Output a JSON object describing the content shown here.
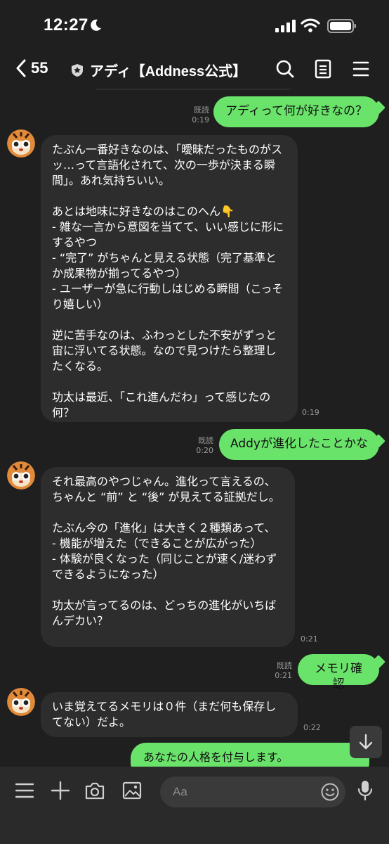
{
  "status": {
    "time": "12:27"
  },
  "header": {
    "back_count": "55",
    "title": "アディ【Addness公式】"
  },
  "messages": [
    {
      "text": "アディって何が好きなの？",
      "read": "既読",
      "time": "0:19"
    },
    {
      "text": "たぶん一番好きなのは、「曖昧だったものがスッ…って言語化されて、次の一歩が決まる瞬間」。あれ気持ちいい。\n\nあとは地味に好きなのはこのへん👇\n- 雑な一言から意図を当てて、いい感じに形にするやつ\n- “完了” がちゃんと見える状態（完了基準とか成果物が揃ってるやつ）\n- ユーザーが急に行動しはじめる瞬間（こっそり嬉しい）\n\n逆に苦手なのは、ふわっとした不安がずっと宙に浮いてる状態。なので見つけたら整理したくなる。\n\n功太は最近、「これ進んだわ」って感じたの何？",
      "time": "0:19"
    },
    {
      "text": "Addyが進化したことかな",
      "read": "既読",
      "time": "0:20"
    },
    {
      "text": "それ最高のやつじゃん。進化って言えるの、ちゃんと “前” と “後” が見えてる証拠だし。\n\nたぶん今の「進化」は大きく２種類あって、\n- 機能が増えた（できることが広がった）\n- 体験が良くなった（同じことが速く/迷わずできるようになった）\n\n功太が言ってるのは、どっちの進化がいちばんデカい？",
      "time": "0:21"
    },
    {
      "text": "メモリ確認",
      "read": "既読",
      "time": "0:21"
    },
    {
      "text": "いま覚えてるメモリは０件（まだ何も保存してない）だよ。",
      "time": "0:22"
    },
    {
      "text": "あなたの人格を付与します。"
    }
  ],
  "input": {
    "placeholder": "Aa"
  },
  "colors": {
    "outgoing": "#6ae36b",
    "incoming": "#2d2d2d",
    "background": "#1f1f1f"
  },
  "icons": [
    "moon-icon",
    "signal-icon",
    "wifi-icon",
    "battery-icon",
    "back-chevron-icon",
    "shield-icon",
    "search-icon",
    "notes-icon",
    "menu-icon",
    "hamburger-icon",
    "plus-icon",
    "camera-icon",
    "image-icon",
    "emoji-icon",
    "mic-icon",
    "arrow-down-icon"
  ]
}
